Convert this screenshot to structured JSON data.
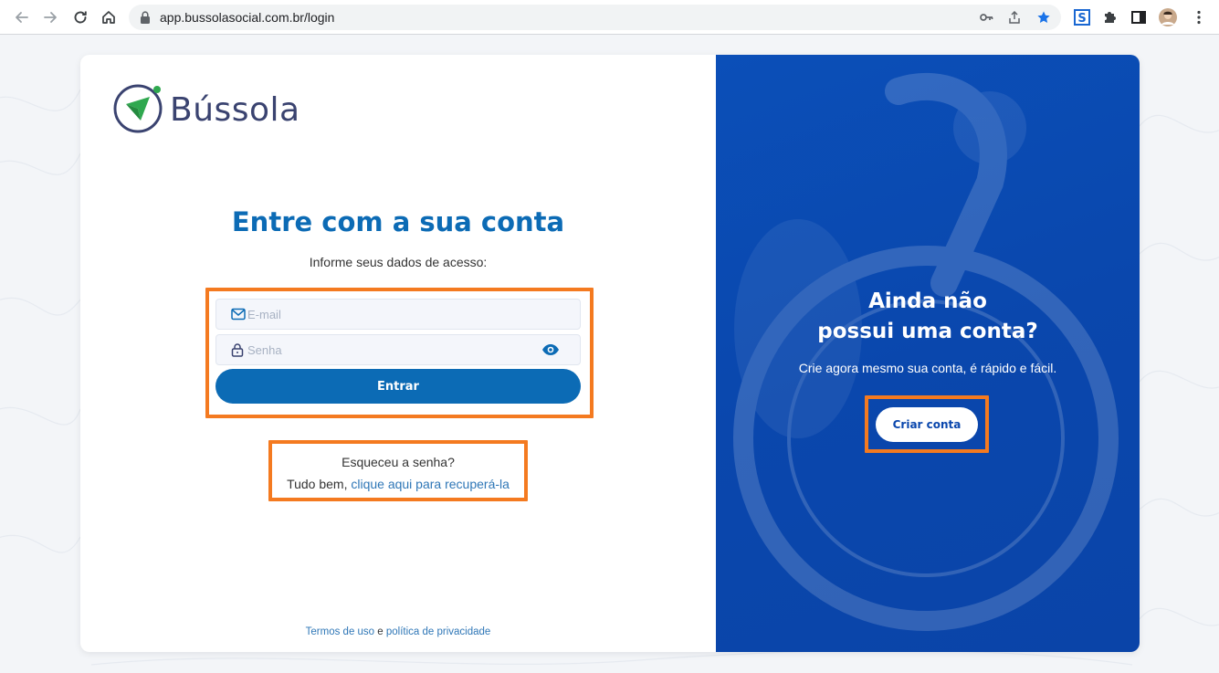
{
  "browser": {
    "url": "app.bussolasocial.com.br/login"
  },
  "brand": {
    "name": "Bússola",
    "primary_color": "#0c6bb5",
    "accent_color": "#f47a20",
    "panel_color": "#0a47ad",
    "logo_green": "#2fa84f"
  },
  "login": {
    "title": "Entre com a sua conta",
    "subtitle": "Informe seus dados de acesso:",
    "email_placeholder": "E-mail",
    "password_placeholder": "Senha",
    "submit_label": "Entrar",
    "forgot_line1": "Esqueceu a senha?",
    "forgot_prefix": "Tudo bem, ",
    "forgot_link": "clique aqui para recuperá-la"
  },
  "footer": {
    "terms": "Termos de uso",
    "conjunction": " e ",
    "privacy": "política de privacidade"
  },
  "signup": {
    "title_line1": "Ainda não",
    "title_line2": "possui uma conta?",
    "subtitle": "Crie agora mesmo sua conta, é rápido e fácil.",
    "button_label": "Criar conta"
  },
  "icons": {
    "back": "arrow-left-icon",
    "forward": "arrow-right-icon",
    "reload": "reload-icon",
    "home": "home-icon",
    "lock": "lock-icon",
    "key": "key-icon",
    "share": "share-icon",
    "bookmark": "star-icon",
    "extension_s": "s-extension-icon",
    "extensions": "puzzle-icon",
    "sidepanel": "side-panel-icon",
    "profile": "avatar",
    "menu": "kebab-menu-icon",
    "mail": "envelope-icon",
    "password": "padlock-icon",
    "show_password": "eye-icon"
  }
}
